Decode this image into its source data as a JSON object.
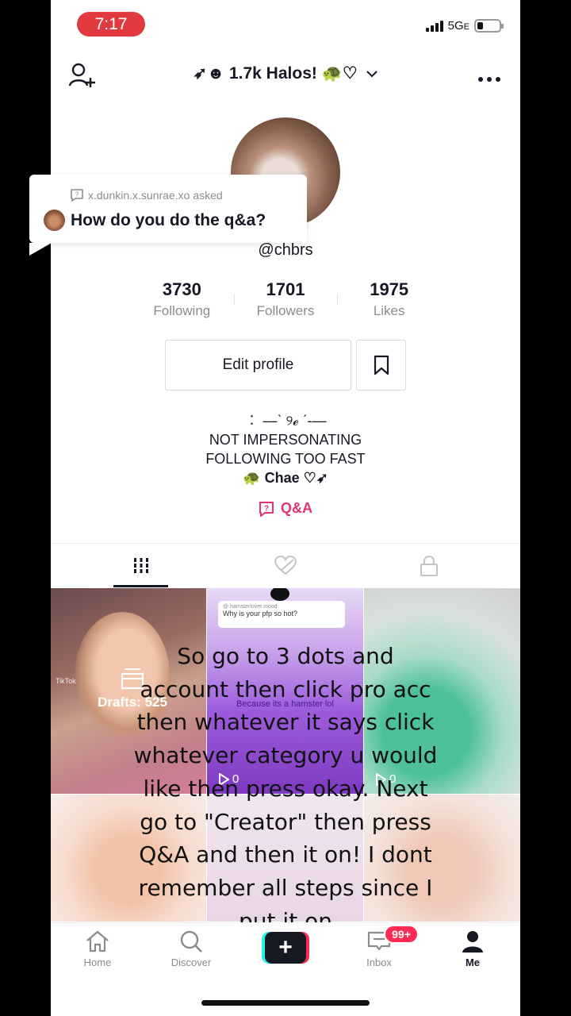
{
  "status_bar": {
    "time": "7:17",
    "network": "5G",
    "network_suffix": "E",
    "battery_level": 0.25
  },
  "header": {
    "title": "➶☻ 1.7k Halos! 🐢♡"
  },
  "profile": {
    "handle": "@chbrs",
    "stats": [
      {
        "value": "3730",
        "label": "Following"
      },
      {
        "value": "1701",
        "label": "Followers"
      },
      {
        "value": "1975",
        "label": "Likes"
      }
    ],
    "edit_button": "Edit profile",
    "bio": [
      "︰ —ˋ ୨ℯ ˊ-—",
      "NOT IMPERSONATING",
      "FOLLOWING TOO FAST",
      "🐢 Chae ♡➶"
    ],
    "qa_link": "Q&A"
  },
  "qa_bubble": {
    "asker": "x.dunkin.x.sunrae.xo asked",
    "question": "How do you do the q&a?"
  },
  "grid": {
    "drafts_label": "Drafts: 525",
    "sticker_asker": "@ hamsterlover.mood",
    "sticker_question": "Why is your pfp so hot?",
    "hamster_caption": "Because its a hamster lol",
    "play_count_2": "0",
    "play_count_3": "0",
    "tiktok_mark": "TikTok"
  },
  "overlay_text": [
    "So go to 3 dots and",
    "account then click pro acc",
    "then whatever it says click",
    "whatever category u would",
    "like then press okay. Next",
    "go to \"Creator\" then press",
    "Q&A and then it on! I dont",
    "remember all steps since I",
    "put it on"
  ],
  "bottom_nav": {
    "home": "Home",
    "discover": "Discover",
    "create": "+",
    "inbox": "Inbox",
    "inbox_badge": "99+",
    "me": "Me"
  },
  "colors": {
    "accent": "#fe2c55",
    "qa": "#e2336b",
    "cyan": "#25f4ee",
    "time_pill": "#e03a3f"
  }
}
